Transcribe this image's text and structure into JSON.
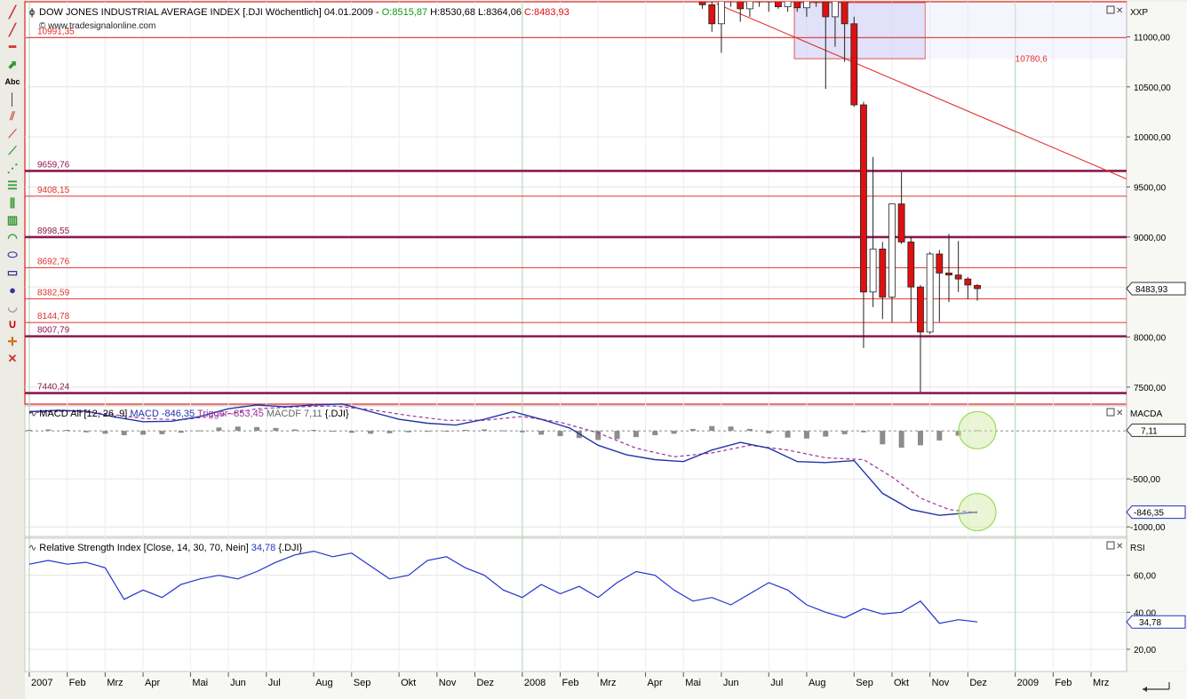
{
  "header": {
    "title": "DOW JONES INDUSTRIAL AVERAGE INDEX [.DJI  Wöchentlich] 04.01.2009 - ",
    "open": "O:8515,87",
    "high": "H:8530,68",
    "low": "L:8364,06",
    "close": "C:8483,93",
    "watermark": "© www.tradesignalonline.com"
  },
  "colors": {
    "up": "#ffffff",
    "down": "#dd1111",
    "macd": "#2233aa",
    "trigger": "#993399",
    "rsi": "#2233cc",
    "hline_red": "#e03030",
    "hline_purple": "#8a1a50",
    "green": "#119911"
  },
  "toolbar": {
    "icons": [
      "pencil-icon",
      "pencil-alt-icon",
      "pencil-red-icon",
      "arrow-up-icon",
      "text-tool-icon",
      "vertical-line-icon",
      "parallel-lines-icon",
      "fan-icon",
      "trend-tool-icon",
      "gann-icon",
      "levels-icon",
      "channel-icon",
      "bars-icon",
      "arc-icon",
      "ellipse-icon",
      "rectangle-icon",
      "circle-icon",
      "half-circle-icon",
      "magnet-icon",
      "crosshair-icon",
      "delete-drawing-icon"
    ],
    "text_tool": "Abc"
  },
  "chart_data": [
    {
      "type": "candlestick",
      "name": "Price",
      "axis_label": "XXP",
      "ylim": [
        7330,
        11350
      ],
      "yticks": [
        7500,
        8000,
        8500,
        9000,
        9500,
        10000,
        10500,
        11000
      ],
      "ytick_labels": [
        "7500,00",
        "8000,00",
        "8500,00",
        "9000,00",
        "9500,00",
        "10000,00",
        "10500,00",
        "11000,00"
      ],
      "last_price": "8483,93",
      "levels": [
        {
          "value": 10991.35,
          "label": "10991,35",
          "style": "red"
        },
        {
          "value": 9659.76,
          "label": "9659,76",
          "style": "purple"
        },
        {
          "value": 9408.15,
          "label": "9408,15",
          "style": "red"
        },
        {
          "value": 8998.55,
          "label": "8998,55",
          "style": "purple"
        },
        {
          "value": 8692.76,
          "label": "8692,76",
          "style": "red"
        },
        {
          "value": 8382.59,
          "label": "8382,59",
          "style": "red"
        },
        {
          "value": 8144.78,
          "label": "8144,78",
          "style": "red"
        },
        {
          "value": 8007.79,
          "label": "8007,79",
          "style": "purple"
        },
        {
          "value": 7440.24,
          "label": "7440,24",
          "style": "purple"
        }
      ],
      "trendline": {
        "start": [
          72.5,
          11330
        ],
        "end": [
          93.5,
          10480
        ],
        "label": "10780,6"
      },
      "candles": [
        {
          "x": 71,
          "o": 11360,
          "h": 11400,
          "l": 11280,
          "c": 11320
        },
        {
          "x": 72,
          "o": 11320,
          "h": 11380,
          "l": 11050,
          "c": 11130
        },
        {
          "x": 73,
          "o": 11130,
          "h": 11450,
          "l": 10840,
          "c": 11420
        },
        {
          "x": 74,
          "o": 11420,
          "h": 11480,
          "l": 11300,
          "c": 11440
        },
        {
          "x": 75,
          "o": 11440,
          "h": 11500,
          "l": 11150,
          "c": 11280
        },
        {
          "x": 76,
          "o": 11280,
          "h": 11420,
          "l": 11200,
          "c": 11390
        },
        {
          "x": 77,
          "o": 11390,
          "h": 11450,
          "l": 11300,
          "c": 11350
        },
        {
          "x": 78,
          "o": 11350,
          "h": 11420,
          "l": 11250,
          "c": 11380
        },
        {
          "x": 79,
          "o": 11380,
          "h": 11460,
          "l": 11280,
          "c": 11300
        },
        {
          "x": 80,
          "o": 11300,
          "h": 11440,
          "l": 11250,
          "c": 11420
        },
        {
          "x": 81,
          "o": 11420,
          "h": 11520,
          "l": 11250,
          "c": 11290
        },
        {
          "x": 82,
          "o": 11290,
          "h": 11450,
          "l": 11200,
          "c": 11420
        },
        {
          "x": 83,
          "o": 11420,
          "h": 11480,
          "l": 11300,
          "c": 11350
        },
        {
          "x": 84,
          "o": 11350,
          "h": 11420,
          "l": 10480,
          "c": 11200
        },
        {
          "x": 85,
          "o": 11200,
          "h": 11480,
          "l": 10900,
          "c": 11420
        },
        {
          "x": 86,
          "o": 11420,
          "h": 11450,
          "l": 10750,
          "c": 11130
        },
        {
          "x": 87,
          "o": 11130,
          "h": 11200,
          "l": 10300,
          "c": 10320
        },
        {
          "x": 88,
          "o": 10320,
          "h": 10350,
          "l": 7890,
          "c": 8450
        },
        {
          "x": 89,
          "o": 8450,
          "h": 9800,
          "l": 8300,
          "c": 8880
        },
        {
          "x": 90,
          "o": 8880,
          "h": 8950,
          "l": 8180,
          "c": 8400
        },
        {
          "x": 91,
          "o": 8400,
          "h": 9300,
          "l": 8150,
          "c": 9330
        },
        {
          "x": 92,
          "o": 9330,
          "h": 9650,
          "l": 8930,
          "c": 8950
        },
        {
          "x": 93,
          "o": 8950,
          "h": 9000,
          "l": 8150,
          "c": 8500
        },
        {
          "x": 94,
          "o": 8500,
          "h": 8520,
          "l": 7450,
          "c": 8050
        },
        {
          "x": 95,
          "o": 8050,
          "h": 8850,
          "l": 8030,
          "c": 8830
        },
        {
          "x": 96,
          "o": 8830,
          "h": 8870,
          "l": 8150,
          "c": 8640
        },
        {
          "x": 97,
          "o": 8640,
          "h": 9030,
          "l": 8350,
          "c": 8620
        },
        {
          "x": 98,
          "o": 8620,
          "h": 8960,
          "l": 8450,
          "c": 8580
        },
        {
          "x": 99,
          "o": 8580,
          "h": 8600,
          "l": 8380,
          "c": 8520
        },
        {
          "x": 100,
          "o": 8515.87,
          "h": 8530.68,
          "l": 8364.06,
          "c": 8483.93
        }
      ]
    },
    {
      "type": "line+bar",
      "name": "MACD",
      "title": "MACD All [12, 26, 9]",
      "macd_label": "MACD -846,35",
      "trigger_label": "Trigger -853,45",
      "macdf_label": "MACDF 7,11",
      "symbol": "{.DJI}",
      "axis_label": "MACDA",
      "ylim": [
        -1100,
        260
      ],
      "yticks": [
        -500,
        -1000
      ],
      "ytick_labels": [
        "-500,00",
        "-1000,00"
      ],
      "last_macdf": "7,11",
      "last_macd": "-846,35",
      "macd": [
        [
          0,
          200
        ],
        [
          3,
          215
        ],
        [
          6,
          205
        ],
        [
          9,
          145
        ],
        [
          12,
          95
        ],
        [
          15,
          100
        ],
        [
          18,
          150
        ],
        [
          21,
          230
        ],
        [
          24,
          270
        ],
        [
          27,
          250
        ],
        [
          30,
          270
        ],
        [
          33,
          280
        ],
        [
          36,
          200
        ],
        [
          39,
          120
        ],
        [
          42,
          80
        ],
        [
          45,
          60
        ],
        [
          48,
          120
        ],
        [
          51,
          200
        ],
        [
          54,
          120
        ],
        [
          57,
          30
        ],
        [
          60,
          -150
        ],
        [
          63,
          -250
        ],
        [
          66,
          -300
        ],
        [
          69,
          -320
        ],
        [
          72,
          -200
        ],
        [
          75,
          -120
        ],
        [
          78,
          -180
        ],
        [
          81,
          -320
        ],
        [
          84,
          -330
        ],
        [
          87,
          -310
        ],
        [
          90,
          -650
        ],
        [
          93,
          -820
        ],
        [
          96,
          -880
        ],
        [
          100,
          -846
        ]
      ],
      "trigger": [
        [
          0,
          190
        ],
        [
          4,
          205
        ],
        [
          8,
          180
        ],
        [
          12,
          130
        ],
        [
          16,
          115
        ],
        [
          20,
          160
        ],
        [
          24,
          230
        ],
        [
          28,
          250
        ],
        [
          32,
          260
        ],
        [
          36,
          220
        ],
        [
          40,
          160
        ],
        [
          44,
          110
        ],
        [
          48,
          110
        ],
        [
          52,
          150
        ],
        [
          56,
          90
        ],
        [
          60,
          -20
        ],
        [
          64,
          -180
        ],
        [
          68,
          -270
        ],
        [
          72,
          -230
        ],
        [
          76,
          -150
        ],
        [
          80,
          -200
        ],
        [
          84,
          -280
        ],
        [
          88,
          -300
        ],
        [
          91,
          -480
        ],
        [
          94,
          -700
        ],
        [
          97,
          -820
        ],
        [
          100,
          -853
        ]
      ],
      "histogram": [
        [
          0,
          10
        ],
        [
          2,
          15
        ],
        [
          4,
          10
        ],
        [
          6,
          -15
        ],
        [
          8,
          -30
        ],
        [
          10,
          -45
        ],
        [
          12,
          -40
        ],
        [
          14,
          -35
        ],
        [
          16,
          -20
        ],
        [
          18,
          5
        ],
        [
          20,
          35
        ],
        [
          22,
          45
        ],
        [
          24,
          40
        ],
        [
          26,
          30
        ],
        [
          28,
          15
        ],
        [
          30,
          10
        ],
        [
          32,
          -5
        ],
        [
          34,
          -20
        ],
        [
          36,
          -30
        ],
        [
          38,
          -25
        ],
        [
          40,
          -15
        ],
        [
          42,
          -10
        ],
        [
          44,
          -5
        ],
        [
          46,
          10
        ],
        [
          48,
          15
        ],
        [
          50,
          5
        ],
        [
          52,
          -15
        ],
        [
          54,
          -40
        ],
        [
          56,
          -55
        ],
        [
          58,
          -75
        ],
        [
          60,
          -95
        ],
        [
          62,
          -85
        ],
        [
          64,
          -65
        ],
        [
          66,
          -45
        ],
        [
          68,
          -30
        ],
        [
          70,
          20
        ],
        [
          72,
          50
        ],
        [
          74,
          45
        ],
        [
          76,
          20
        ],
        [
          78,
          -25
        ],
        [
          80,
          -70
        ],
        [
          82,
          -80
        ],
        [
          84,
          -60
        ],
        [
          86,
          -35
        ],
        [
          88,
          -15
        ],
        [
          90,
          -140
        ],
        [
          92,
          -175
        ],
        [
          94,
          -150
        ],
        [
          96,
          -100
        ],
        [
          98,
          -50
        ],
        [
          100,
          7.11
        ]
      ],
      "annotations": [
        {
          "x": 100,
          "y": 7.11
        },
        {
          "x": 100,
          "y": -846
        }
      ]
    },
    {
      "type": "line",
      "name": "RSI",
      "title": "Relative Strength Index [Close, 14, 30, 70, Nein]",
      "value_label": "34,78",
      "symbol": "{.DJI}",
      "axis_label": "RSI",
      "ylim": [
        8,
        80
      ],
      "yticks": [
        20,
        40,
        60
      ],
      "ytick_labels": [
        "20,00",
        "40,00",
        "60,00"
      ],
      "last_value": "34,78",
      "values": [
        [
          0,
          66
        ],
        [
          2,
          68
        ],
        [
          4,
          66
        ],
        [
          6,
          67
        ],
        [
          8,
          64
        ],
        [
          10,
          47
        ],
        [
          12,
          52
        ],
        [
          14,
          48
        ],
        [
          16,
          55
        ],
        [
          18,
          58
        ],
        [
          20,
          60
        ],
        [
          22,
          58
        ],
        [
          24,
          62
        ],
        [
          26,
          67
        ],
        [
          28,
          71
        ],
        [
          30,
          73
        ],
        [
          32,
          70
        ],
        [
          34,
          72
        ],
        [
          36,
          65
        ],
        [
          38,
          58
        ],
        [
          40,
          60
        ],
        [
          42,
          68
        ],
        [
          44,
          70
        ],
        [
          46,
          64
        ],
        [
          48,
          60
        ],
        [
          50,
          52
        ],
        [
          52,
          48
        ],
        [
          54,
          55
        ],
        [
          56,
          50
        ],
        [
          58,
          54
        ],
        [
          60,
          48
        ],
        [
          62,
          56
        ],
        [
          64,
          62
        ],
        [
          66,
          60
        ],
        [
          68,
          52
        ],
        [
          70,
          46
        ],
        [
          72,
          48
        ],
        [
          74,
          44
        ],
        [
          76,
          50
        ],
        [
          78,
          56
        ],
        [
          80,
          52
        ],
        [
          82,
          44
        ],
        [
          84,
          40
        ],
        [
          86,
          37
        ],
        [
          88,
          42
        ],
        [
          90,
          39
        ],
        [
          92,
          40
        ],
        [
          94,
          46
        ],
        [
          96,
          34
        ],
        [
          98,
          36
        ],
        [
          100,
          34.78
        ]
      ]
    }
  ],
  "xaxis": {
    "labels": [
      {
        "x": 0,
        "t": "2007"
      },
      {
        "x": 4,
        "t": "Feb"
      },
      {
        "x": 8,
        "t": "Mrz"
      },
      {
        "x": 12,
        "t": "Apr"
      },
      {
        "x": 17,
        "t": "Mai"
      },
      {
        "x": 21,
        "t": "Jun"
      },
      {
        "x": 25,
        "t": "Jul"
      },
      {
        "x": 30,
        "t": "Aug"
      },
      {
        "x": 34,
        "t": "Sep"
      },
      {
        "x": 39,
        "t": "Okt"
      },
      {
        "x": 43,
        "t": "Nov"
      },
      {
        "x": 47,
        "t": "Dez"
      },
      {
        "x": 52,
        "t": "2008"
      },
      {
        "x": 56,
        "t": "Feb"
      },
      {
        "x": 60,
        "t": "Mrz"
      },
      {
        "x": 65,
        "t": "Apr"
      },
      {
        "x": 69,
        "t": "Mai"
      },
      {
        "x": 73,
        "t": "Jun"
      },
      {
        "x": 78,
        "t": "Jul"
      },
      {
        "x": 82,
        "t": "Aug"
      },
      {
        "x": 87,
        "t": "Sep"
      },
      {
        "x": 91,
        "t": "Okt"
      },
      {
        "x": 95,
        "t": "Nov"
      },
      {
        "x": 99,
        "t": "Dez"
      },
      {
        "x": 104,
        "t": "2009"
      },
      {
        "x": 108,
        "t": "Feb"
      },
      {
        "x": 112,
        "t": "Mrz"
      }
    ]
  }
}
